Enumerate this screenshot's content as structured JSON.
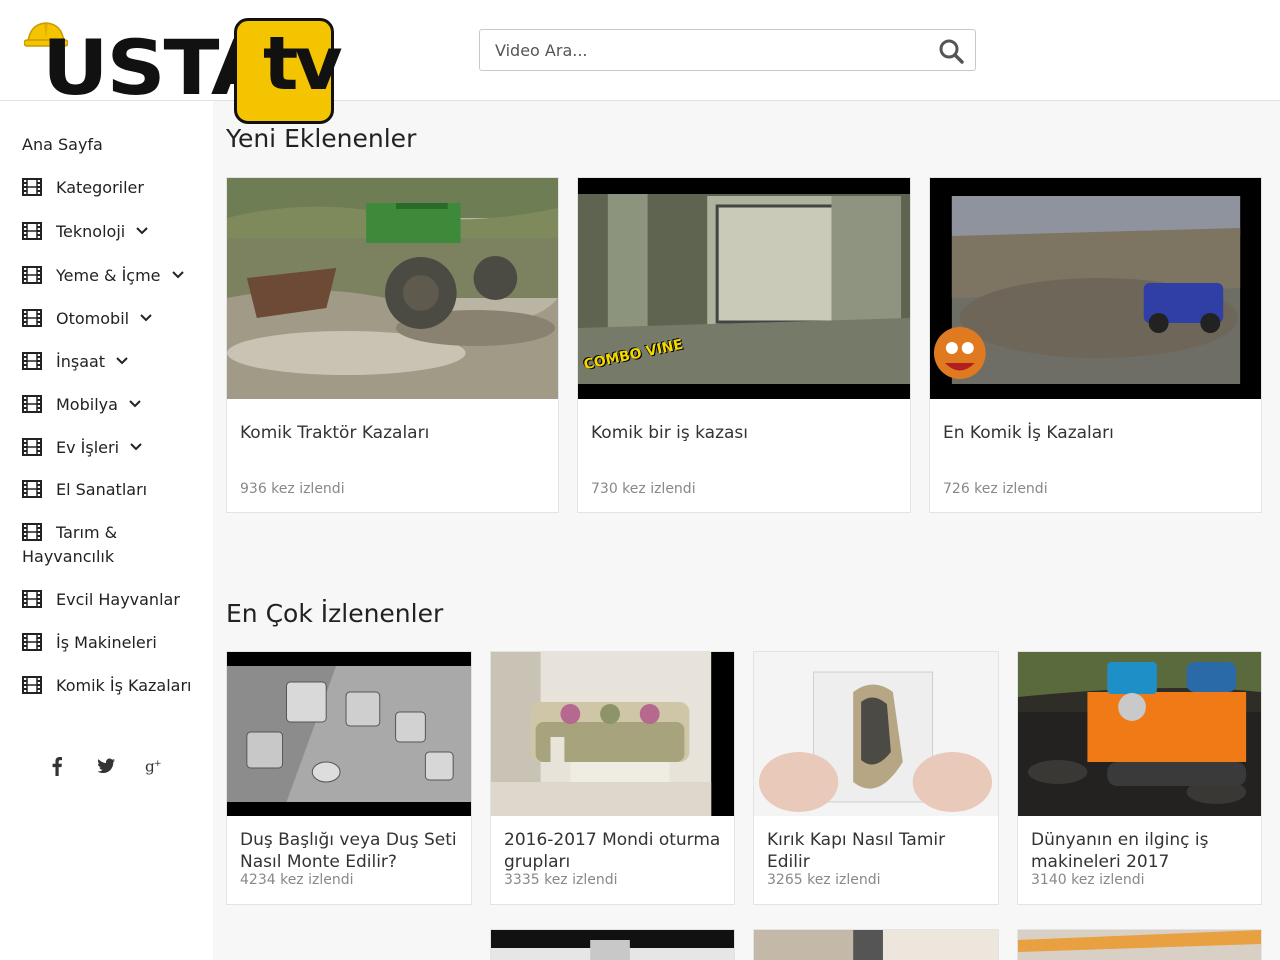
{
  "brand": {
    "logo_text": "USTA",
    "logo_tv": "tv",
    "accent": "#f5c400"
  },
  "search": {
    "placeholder": "Video Ara..."
  },
  "sidebar": {
    "home": "Ana Sayfa",
    "items": [
      {
        "label": "Kategoriler",
        "has_children": false
      },
      {
        "label": "Teknoloji",
        "has_children": true
      },
      {
        "label": "Yeme & İçme",
        "has_children": true
      },
      {
        "label": "Otomobil",
        "has_children": true
      },
      {
        "label": "İnşaat",
        "has_children": true
      },
      {
        "label": "Mobilya",
        "has_children": true
      },
      {
        "label": "Ev İşleri",
        "has_children": true
      },
      {
        "label": "El Sanatları",
        "has_children": false
      },
      {
        "label": "Tarım &",
        "label2": "Hayvancılık",
        "has_children": false
      },
      {
        "label": "Evcil Hayvanlar",
        "has_children": false
      },
      {
        "label": "İş Makineleri",
        "has_children": false
      },
      {
        "label": "Komik İş Kazaları",
        "has_children": false
      }
    ],
    "social": [
      "facebook-icon",
      "twitter-icon",
      "google-plus-icon"
    ]
  },
  "sections": {
    "new": {
      "title": "Yeni Eklenenler",
      "videos": [
        {
          "title": "Komik Traktör Kazaları",
          "views": "936 kez izlendi"
        },
        {
          "title": "Komik bir iş kazası",
          "views": "730 kez izlendi",
          "overlay": "COMBO VINE"
        },
        {
          "title": "En Komik İş Kazaları",
          "views": "726 kez izlendi"
        }
      ]
    },
    "popular": {
      "title": "En Çok İzlenenler",
      "videos": [
        {
          "title": "Duş Başlığı veya Duş Seti Nasıl Monte Edilir?",
          "views": "4234 kez izlendi"
        },
        {
          "title": "2016-2017 Mondi oturma grupları",
          "views": "3335 kez izlendi"
        },
        {
          "title": "Kırık Kapı Nasıl Tamir Edilir",
          "views": "3265 kez izlendi"
        },
        {
          "title": "Dünyanın en ilginç iş makineleri 2017",
          "views": "3140 kez izlendi"
        }
      ]
    }
  }
}
